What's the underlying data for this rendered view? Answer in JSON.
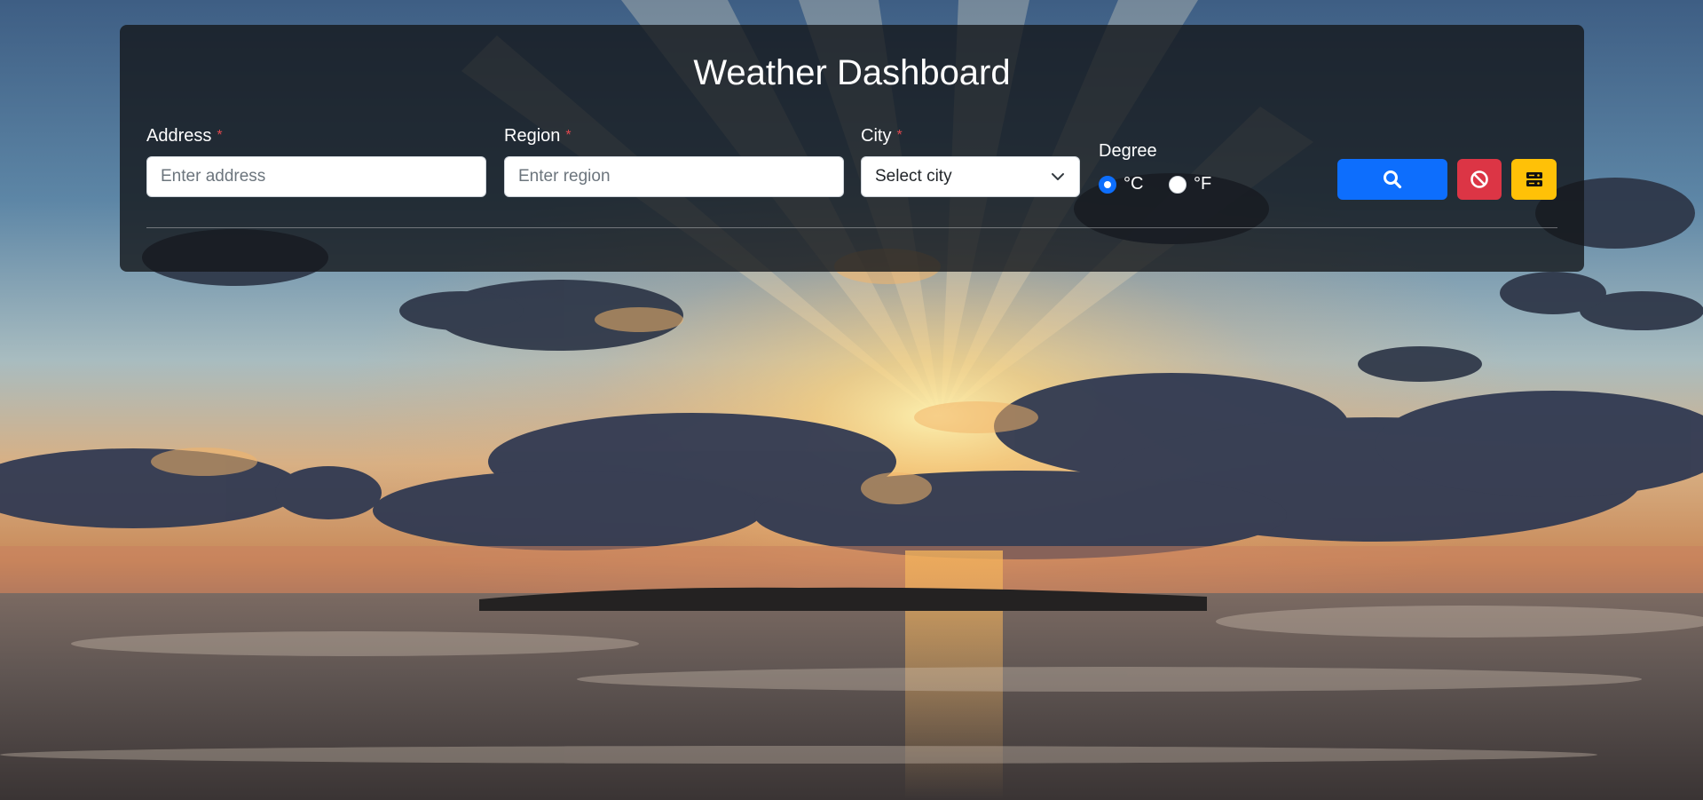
{
  "header": {
    "title": "Weather Dashboard"
  },
  "form": {
    "address": {
      "label": "Address",
      "required_mark": "*",
      "placeholder": "Enter address",
      "value": ""
    },
    "region": {
      "label": "Region",
      "required_mark": "*",
      "placeholder": "Enter region",
      "value": ""
    },
    "city": {
      "label": "City",
      "required_mark": "*",
      "selected": "Select city"
    },
    "degree": {
      "label": "Degree",
      "options": [
        {
          "label": "°C",
          "checked": true
        },
        {
          "label": "°F",
          "checked": false
        }
      ]
    }
  },
  "buttons": {
    "search_icon": "search-icon",
    "clear_icon": "ban-icon",
    "storage_icon": "server-icon"
  },
  "colors": {
    "primary": "#0d6efd",
    "danger": "#dc3545",
    "warning": "#ffc107",
    "required": "#e0484e",
    "panel": "rgba(20,22,26,0.80)"
  }
}
